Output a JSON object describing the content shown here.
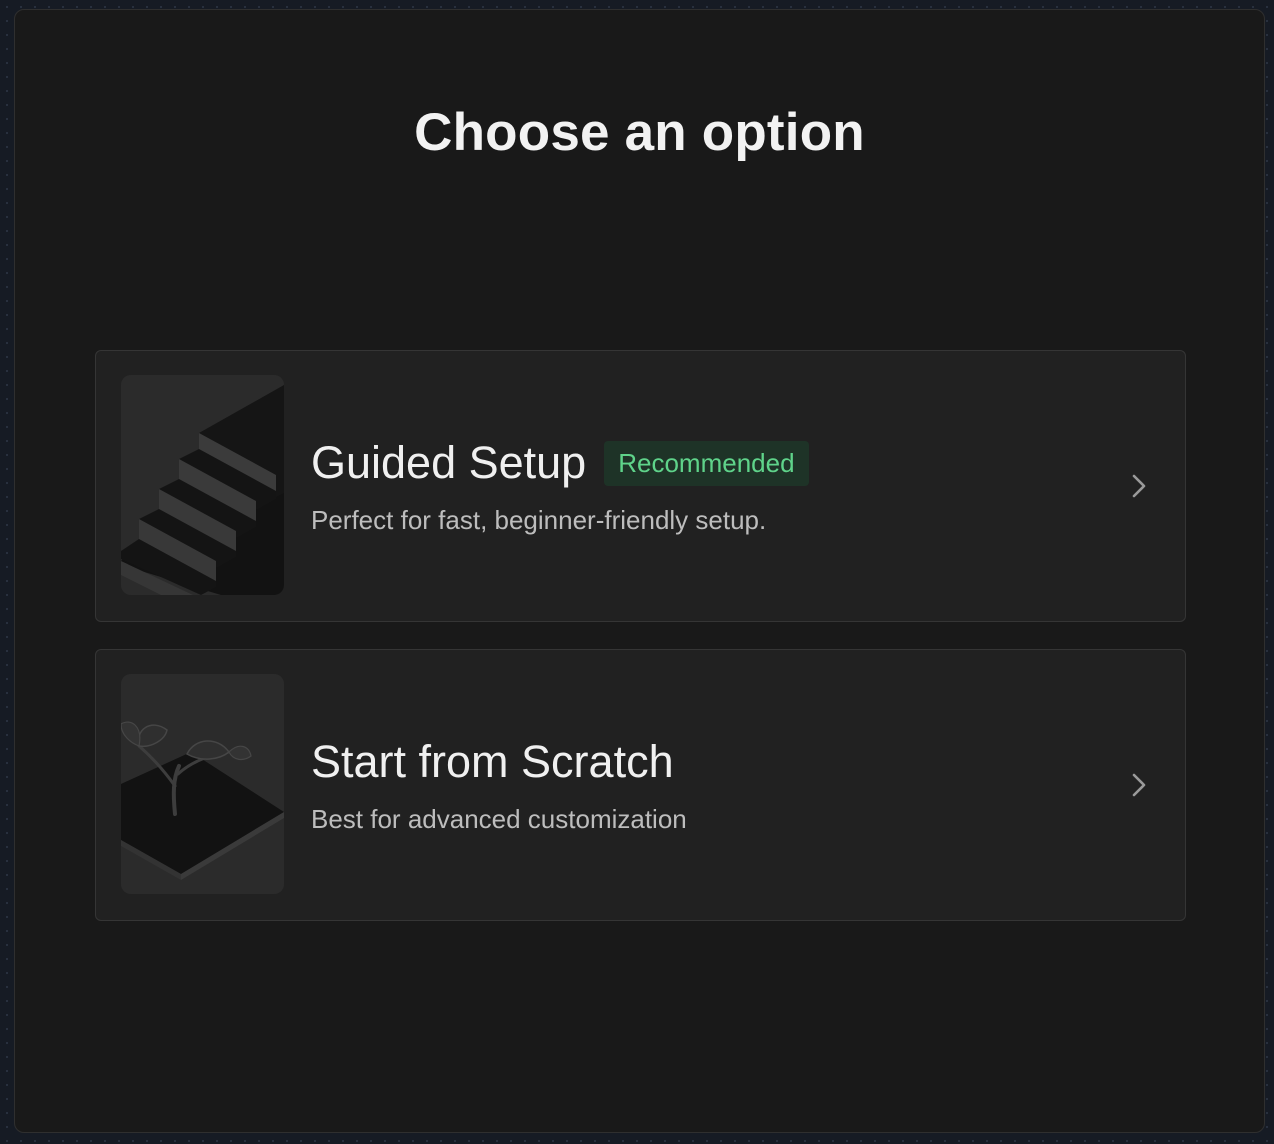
{
  "dialog": {
    "title": "Choose an option"
  },
  "options": [
    {
      "title": "Guided Setup",
      "badge": "Recommended",
      "description": "Perfect for fast, beginner-friendly setup.",
      "illustration": "staircase",
      "action_icon": "chevron-right-icon"
    },
    {
      "title": "Start from Scratch",
      "description": "Best for advanced customization",
      "illustration": "sprout",
      "action_icon": "chevron-right-icon"
    }
  ],
  "colors": {
    "background": "#191919",
    "card": "#212121",
    "badge_bg": "#1e3327",
    "badge_text": "#5fd38a"
  }
}
